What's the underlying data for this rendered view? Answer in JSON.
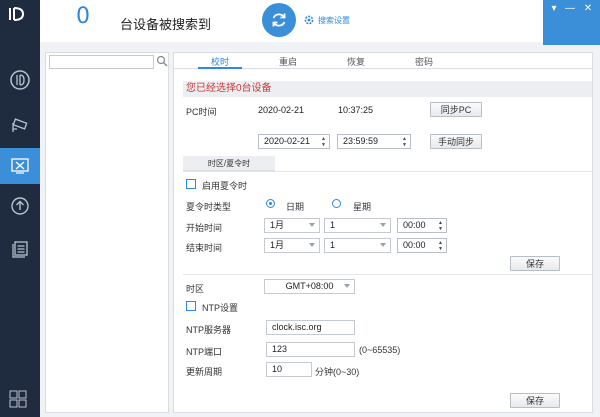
{
  "header": {
    "device_count": "0",
    "device_count_label": "台设备被搜索到",
    "search_settings_label": "搜索设置"
  },
  "tabs": [
    {
      "label": "校时",
      "active": true
    },
    {
      "label": "重启",
      "active": false
    },
    {
      "label": "恢复",
      "active": false
    },
    {
      "label": "密码",
      "active": false
    }
  ],
  "time_sync": {
    "notice": "您已经选择0台设备",
    "pc_time_label": "PC时间",
    "pc_date": "2020-02-21",
    "pc_time": "10:37:25",
    "sync_pc_button": "同步PC",
    "manual_date": "2020-02-21",
    "manual_time": "23:59:59",
    "manual_sync_button": "手动同步"
  },
  "dst": {
    "section_tab": "时区/夏令时",
    "enable_label": "启用夏令时",
    "type_label": "夏令时类型",
    "option_date": "日期",
    "option_week": "星期",
    "start_label": "开始时间",
    "end_label": "结束时间",
    "start_month": "1月",
    "start_day": "1",
    "start_time": "00:00",
    "end_month": "1月",
    "end_day": "1",
    "end_time": "00:00",
    "save_button": "保存"
  },
  "timezone": {
    "label": "时区",
    "value": "GMT+08:00"
  },
  "ntp": {
    "enable_label": "NTP设置",
    "server_label": "NTP服务器",
    "server_value": "clock.isc.org",
    "port_label": "NTP端口",
    "port_value": "123",
    "port_hint": "(0~65535)",
    "period_label": "更新周期",
    "period_value": "10",
    "period_hint": "分钟(0~30)",
    "save_button": "保存"
  },
  "colors": {
    "accent": "#3b8fd8",
    "sidebar": "#1f2b3e",
    "warning_text": "#c9383a"
  },
  "icons": [
    "logo-icon",
    "camera-icon",
    "cctv-icon",
    "tools-icon",
    "upgrade-icon",
    "files-icon",
    "apps-grid-icon",
    "refresh-icon",
    "gear-icon",
    "search-icon",
    "minimize-icon",
    "close-icon"
  ]
}
